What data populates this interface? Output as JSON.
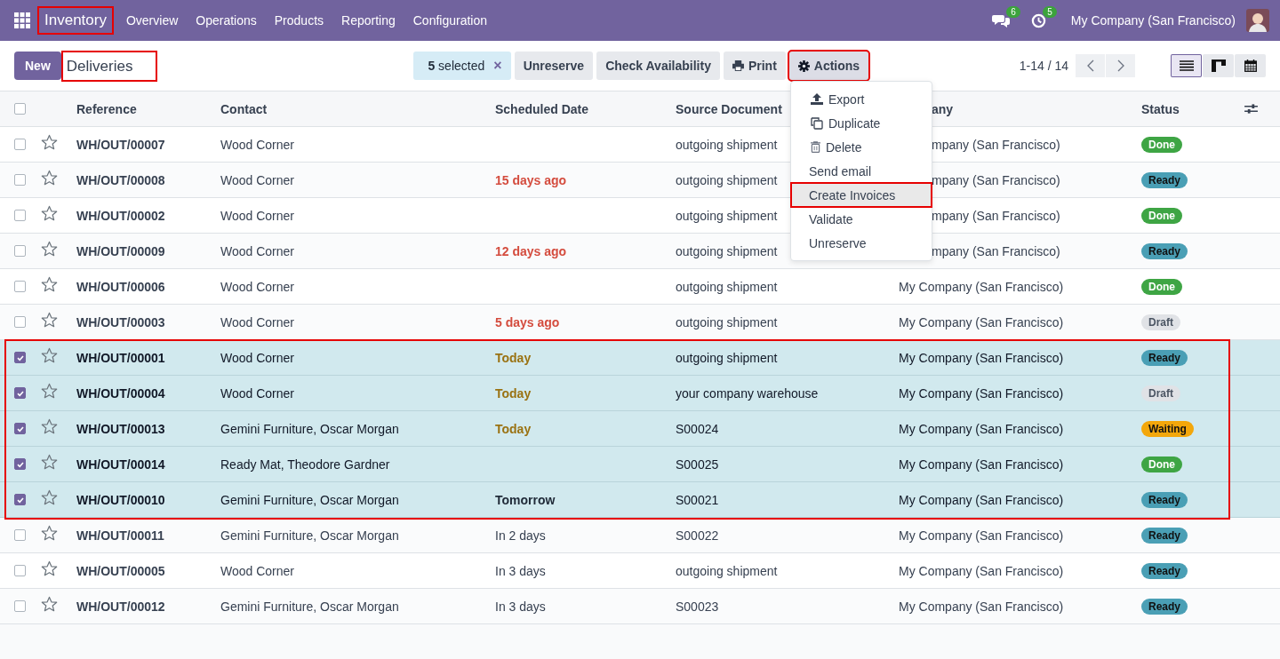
{
  "navbar": {
    "app": {
      "label": "Inventory",
      "highlighted": true
    },
    "menu": [
      "Overview",
      "Operations",
      "Products",
      "Reporting",
      "Configuration"
    ],
    "messages_badge": "6",
    "activities_badge": "5",
    "company": "My Company (San Francisco)"
  },
  "control_panel": {
    "new_button": "New",
    "breadcrumb": {
      "label": "Deliveries",
      "highlighted": true
    },
    "selection": "**5** selected",
    "clear_icon": "×",
    "buttons": [
      {
        "label": "Unreserve",
        "kind": "plain",
        "highlighted": false
      },
      {
        "label": "Check Availability",
        "kind": "plain",
        "highlighted": false
      },
      {
        "label": "Print",
        "kind": "print",
        "highlighted": false
      },
      {
        "label": "Actions",
        "kind": "gear",
        "highlighted": true
      }
    ],
    "pager": "1-14 / 14",
    "views": [
      {
        "kind": "list",
        "selected": true
      },
      {
        "kind": "kanban",
        "selected": false
      },
      {
        "kind": "calendar",
        "selected": false
      }
    ]
  },
  "actions_menu": [
    {
      "label": "Export",
      "kind": "export",
      "highlighted": false
    },
    {
      "label": "Duplicate",
      "kind": "duplicate",
      "highlighted": false
    },
    {
      "label": "Delete",
      "kind": "delete",
      "highlighted": false
    },
    {
      "label": "Send email",
      "kind": "plain",
      "highlighted": false
    },
    {
      "label": "Create Invoices",
      "kind": "plain",
      "highlighted": true
    },
    {
      "label": "Validate",
      "kind": "plain",
      "highlighted": false
    },
    {
      "label": "Unreserve",
      "kind": "plain",
      "highlighted": false
    }
  ],
  "table": {
    "all_selected": false,
    "columns": [
      {
        "label": "Reference",
        "under_menu": false
      },
      {
        "label": "Contact",
        "under_menu": false
      },
      {
        "label": "Scheduled Date",
        "under_menu": false
      },
      {
        "label": "Source Document",
        "under_menu": false
      },
      {
        "label": "any",
        "under_menu": true
      },
      {
        "label": "Status",
        "under_menu": false
      }
    ],
    "rows": [
      {
        "selected": false,
        "highlighted": false,
        "reference": "WH/OUT/00007",
        "contact": "Wood Corner",
        "source": "outgoing shipment",
        "company": "mpany (San Francisco)",
        "under_menu": true,
        "status": {
          "label": "Done",
          "color": "#3ea544"
        }
      },
      {
        "selected": false,
        "highlighted": false,
        "reference": "WH/OUT/00008",
        "contact": "Wood Corner",
        "date": {
          "text": "15 days ago",
          "color": "#d44c3e"
        },
        "source": "outgoing shipment",
        "company": "mpany (San Francisco)",
        "under_menu": true,
        "status": {
          "label": "Ready",
          "color": "#4a9fb5"
        }
      },
      {
        "selected": false,
        "highlighted": false,
        "reference": "WH/OUT/00002",
        "contact": "Wood Corner",
        "source": "outgoing shipment",
        "company": "mpany (San Francisco)",
        "under_menu": true,
        "status": {
          "label": "Done",
          "color": "#3ea544"
        }
      },
      {
        "selected": false,
        "highlighted": false,
        "reference": "WH/OUT/00009",
        "contact": "Wood Corner",
        "date": {
          "text": "12 days ago",
          "color": "#d44c3e"
        },
        "source": "outgoing shipment",
        "company": "mpany (San Francisco)",
        "under_menu": true,
        "status": {
          "label": "Ready",
          "color": "#4a9fb5"
        }
      },
      {
        "selected": false,
        "highlighted": false,
        "reference": "WH/OUT/00006",
        "contact": "Wood Corner",
        "source": "outgoing shipment",
        "company": "My Company (San Francisco)",
        "under_menu": false,
        "status": {
          "label": "Done",
          "color": "#3ea544"
        }
      },
      {
        "selected": false,
        "highlighted": false,
        "reference": "WH/OUT/00003",
        "contact": "Wood Corner",
        "date": {
          "text": "5 days ago",
          "color": "#d44c3e"
        },
        "source": "outgoing shipment",
        "company": "My Company (San Francisco)",
        "under_menu": false,
        "status": {
          "label": "Draft",
          "color": "#e0e2e6"
        }
      },
      {
        "selected": true,
        "highlighted": true,
        "reference": "WH/OUT/00001",
        "contact": "Wood Corner",
        "date": {
          "text": "Today",
          "color": "#9a7212"
        },
        "source": "outgoing shipment",
        "company": "My Company (San Francisco)",
        "under_menu": false,
        "status": {
          "label": "Ready",
          "color": "#4a9fb5"
        }
      },
      {
        "selected": true,
        "highlighted": true,
        "reference": "WH/OUT/00004",
        "contact": "Wood Corner",
        "date": {
          "text": "Today",
          "color": "#9a7212"
        },
        "source": "your company warehouse",
        "company": "My Company (San Francisco)",
        "under_menu": false,
        "status": {
          "label": "Draft",
          "color": "#e0e2e6"
        }
      },
      {
        "selected": true,
        "highlighted": true,
        "reference": "WH/OUT/00013",
        "contact": "Gemini Furniture, Oscar Morgan",
        "date": {
          "text": "Today",
          "color": "#9a7212"
        },
        "source": "S00024",
        "company": "My Company (San Francisco)",
        "under_menu": false,
        "status": {
          "label": "Waiting",
          "color": "#f3a70b"
        }
      },
      {
        "selected": true,
        "highlighted": true,
        "reference": "WH/OUT/00014",
        "contact": "Ready Mat, Theodore Gardner",
        "source": "S00025",
        "company": "My Company (San Francisco)",
        "under_menu": false,
        "status": {
          "label": "Done",
          "color": "#3ea544"
        }
      },
      {
        "selected": true,
        "highlighted": true,
        "reference": "WH/OUT/00010",
        "contact": "Gemini Furniture, Oscar Morgan",
        "date": {
          "text": "Tomorrow",
          "color": "#1f2937"
        },
        "source": "S00021",
        "company": "My Company (San Francisco)",
        "under_menu": false,
        "status": {
          "label": "Ready",
          "color": "#4a9fb5"
        }
      },
      {
        "selected": false,
        "highlighted": false,
        "reference": "WH/OUT/00011",
        "contact": "Gemini Furniture, Oscar Morgan",
        "date": {
          "text": "In 2 days",
          "color": "#374151"
        },
        "source": "S00022",
        "company": "My Company (San Francisco)",
        "under_menu": false,
        "status": {
          "label": "Ready",
          "color": "#4a9fb5"
        }
      },
      {
        "selected": false,
        "highlighted": false,
        "reference": "WH/OUT/00005",
        "contact": "Wood Corner",
        "date": {
          "text": "In 3 days",
          "color": "#374151"
        },
        "source": "outgoing shipment",
        "company": "My Company (San Francisco)",
        "under_menu": false,
        "status": {
          "label": "Ready",
          "color": "#4a9fb5"
        }
      },
      {
        "selected": false,
        "highlighted": false,
        "reference": "WH/OUT/00012",
        "contact": "Gemini Furniture, Oscar Morgan",
        "date": {
          "text": "In 3 days",
          "color": "#374151"
        },
        "source": "S00023",
        "company": "My Company (San Francisco)",
        "under_menu": false,
        "status": {
          "label": "Ready",
          "color": "#4a9fb5"
        }
      }
    ]
  }
}
